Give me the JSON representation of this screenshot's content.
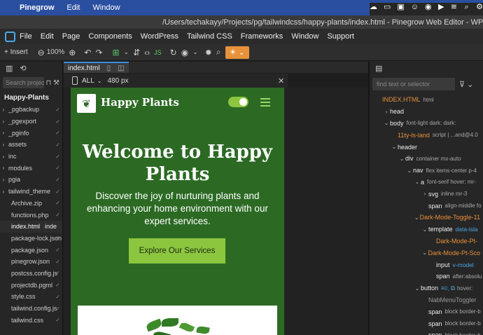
{
  "macmenu": {
    "apple": "",
    "items": [
      "Pinegrow",
      "Edit",
      "Window"
    ]
  },
  "window": {
    "title": "/Users/techakayy/Projects/pg/tailwindcss/happy-plants/index.html - Pinegrow Web Editor - WP"
  },
  "appmenu": {
    "items": [
      "File",
      "Edit",
      "Page",
      "Components",
      "WordPress",
      "Tailwind CSS",
      "Frameworks",
      "Window",
      "Support"
    ]
  },
  "toolbar": {
    "insert_label": "+ Insert",
    "zoom_label": "100%"
  },
  "left_panel": {
    "search_placeholder": "Search project",
    "project_name": "Happy-Plants",
    "files": [
      {
        "name": "_pgbackup",
        "folder": true
      },
      {
        "name": "_pgexport",
        "folder": true
      },
      {
        "name": "_pginfo",
        "folder": true
      },
      {
        "name": "assets",
        "folder": true
      },
      {
        "name": "inc",
        "folder": true
      },
      {
        "name": "modules",
        "folder": true
      },
      {
        "name": "pgia",
        "folder": true
      },
      {
        "name": "tailwind_theme",
        "folder": true
      },
      {
        "name": "Archive.zip",
        "folder": false
      },
      {
        "name": "functions.php",
        "folder": false
      },
      {
        "name": "index.html",
        "folder": false,
        "active": true,
        "badge": "inde"
      },
      {
        "name": "package-lock.json",
        "folder": false
      },
      {
        "name": "package.json",
        "folder": false
      },
      {
        "name": "pinegrow.json",
        "folder": false
      },
      {
        "name": "postcss.config.js",
        "folder": false
      },
      {
        "name": "projectdb.pgml",
        "folder": false
      },
      {
        "name": "style.css",
        "folder": false
      },
      {
        "name": "tailwind.config.js",
        "folder": false
      },
      {
        "name": "tailwind.css",
        "folder": false
      }
    ]
  },
  "editor": {
    "tab_label": "index.html",
    "device_label": "ALL",
    "width_label": "480 px"
  },
  "site": {
    "brand": "Happy Plants",
    "heading": "Welcome to Happy Plants",
    "lead": "Discover the joy of nurturing plants and enhancing your home environment with our expert services.",
    "cta": "Explore Our Services"
  },
  "right_panel": {
    "search_placeholder": "find text or selector",
    "nodes": [
      {
        "indent": 0,
        "tag": "INDEX.HTML",
        "cls": "html",
        "orange": true
      },
      {
        "indent": 1,
        "chev": "›",
        "tag": "head",
        "cls": ""
      },
      {
        "indent": 1,
        "chev": "⌄",
        "tag": "body",
        "cls": "font-light  dark:  dark:"
      },
      {
        "indent": 2,
        "tag": "11ty-ls-land",
        "cls": "script | ...and@4.0",
        "orange": true
      },
      {
        "indent": 2,
        "chev": "⌄",
        "tag": "header",
        "cls": ""
      },
      {
        "indent": 3,
        "chev": "⌄",
        "tag": "div",
        "cls": "container mx-auto"
      },
      {
        "indent": 4,
        "chev": "⌄",
        "tag": "nav",
        "cls": "flex items-center p-4"
      },
      {
        "indent": 5,
        "chev": "⌄",
        "tag": "a",
        "cls": "font-serif hover:  mr-"
      },
      {
        "indent": 6,
        "chev": "›",
        "tag": "svg",
        "cls": "inline mr-3"
      },
      {
        "indent": 6,
        "tag": "span",
        "cls": "align-middle fo"
      },
      {
        "indent": 5,
        "chev": "⌄",
        "tag": "Dark-Mode-Toggle-11",
        "cls": "",
        "orange": true
      },
      {
        "indent": 6,
        "chev": "⌄",
        "tag": "template",
        "cls": "",
        "attr": "data-isla"
      },
      {
        "indent": 7,
        "tag": "Dark-Mode-Pt-",
        "cls": "",
        "orange": true
      },
      {
        "indent": 6,
        "chev": "⌄",
        "tag": "Dark-Mode-Pt-Sco",
        "cls": "",
        "orange": true
      },
      {
        "indent": 7,
        "tag": "input",
        "cls": "",
        "attr": "v-model"
      },
      {
        "indent": 7,
        "tag": "span",
        "cls": "after:absolu"
      },
      {
        "indent": 5,
        "chev": "⌄",
        "tag": "button",
        "cls": "hover:",
        "attr": "≡◊, ⧉"
      },
      {
        "indent": 6,
        "tag": "NabMenuToggler",
        "cls": "",
        "dim": true
      },
      {
        "indent": 6,
        "tag": "span",
        "cls": "block border-b"
      },
      {
        "indent": 6,
        "tag": "span",
        "cls": "block border-b"
      },
      {
        "indent": 6,
        "tag": "span",
        "cls": "block border-b"
      }
    ]
  }
}
